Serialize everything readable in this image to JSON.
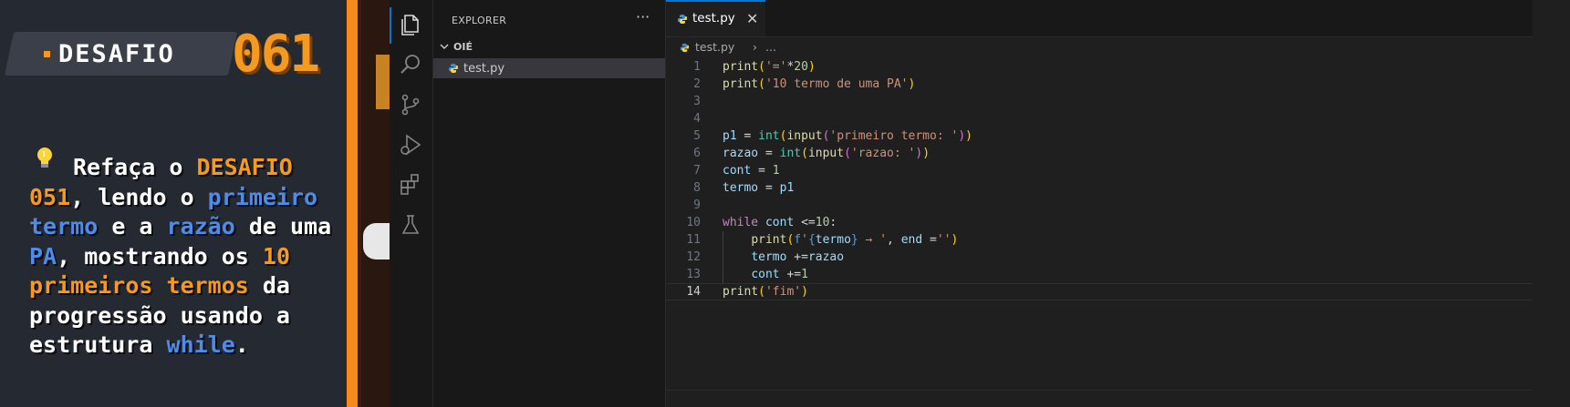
{
  "challenge": {
    "label": "DESAFIO",
    "number": "061",
    "text_parts": [
      "Refaça o ",
      "DESAFIO",
      "051",
      ", lendo o ",
      "primeiro",
      "termo",
      " e a ",
      "razão",
      " de uma ",
      "PA",
      ", mostrando os ",
      "10",
      "primeiros termos",
      " da",
      "progressão usando a",
      "estrutura ",
      "while",
      "."
    ]
  },
  "activity_bar": {
    "items": [
      {
        "icon": "explorer-icon"
      },
      {
        "icon": "search-icon"
      },
      {
        "icon": "source-control-icon"
      },
      {
        "icon": "run-debug-icon"
      },
      {
        "icon": "extensions-icon"
      },
      {
        "icon": "testing-icon"
      }
    ]
  },
  "sidebar": {
    "title": "EXPLORER",
    "more": "···",
    "folder": "OIÉ",
    "file": "test.py"
  },
  "editor": {
    "tab_label": "test.py",
    "tab_close": "✕",
    "breadcrumb_file": "test.py",
    "breadcrumb_sep": "›",
    "breadcrumb_more": "...",
    "current_line": 14,
    "lines": [
      {
        "n": "1"
      },
      {
        "n": "2"
      },
      {
        "n": "3"
      },
      {
        "n": "4"
      },
      {
        "n": "5"
      },
      {
        "n": "6"
      },
      {
        "n": "7"
      },
      {
        "n": "8"
      },
      {
        "n": "9"
      },
      {
        "n": "10"
      },
      {
        "n": "11"
      },
      {
        "n": "12"
      },
      {
        "n": "13"
      },
      {
        "n": "14"
      }
    ],
    "code_text": [
      "print('='*20)",
      "print('10 termo de uma PA')",
      "",
      "",
      "p1 = int(input('primeiro termo: '))",
      "razao = int(input('razao: '))",
      "cont = 1",
      "termo = p1",
      "",
      "while cont <=10:",
      "    print(f'{termo} → ', end ='')",
      "    termo +=razao",
      "    cont +=1",
      "print('fim')"
    ]
  },
  "colors": {
    "accent": "#0078d4",
    "challenge_orange": "#f59a1e",
    "challenge_blue": "#4f8ce8",
    "string": "#ce9178",
    "function": "#dcdcaa",
    "keyword": "#c586c0",
    "variable": "#9cdcfe",
    "number": "#b5cea8"
  }
}
